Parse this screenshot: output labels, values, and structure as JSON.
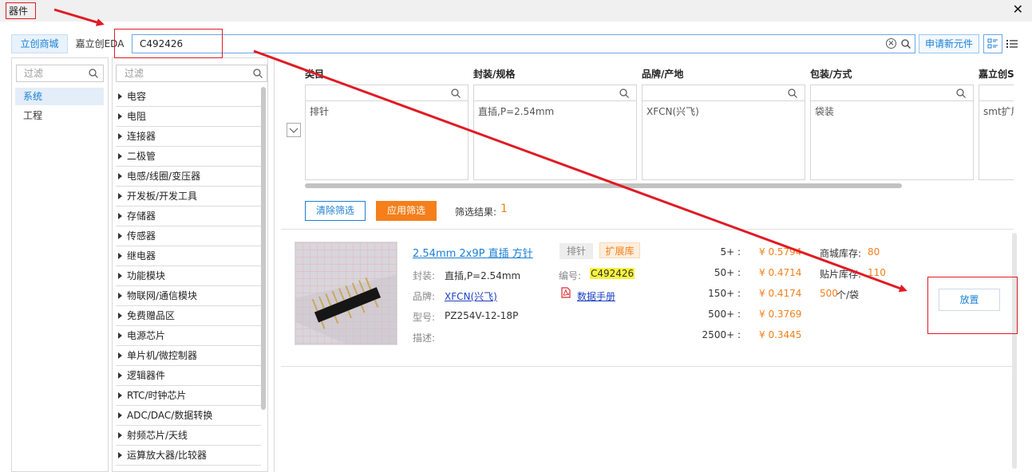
{
  "window": {
    "title": "器件"
  },
  "search": {
    "tab_mall": "立创商城",
    "tab_eda": "嘉立创EDA",
    "value": "C492426",
    "apply_new": "申请新元件"
  },
  "libraries": {
    "filter_placeholder": "过滤",
    "items": [
      "系统",
      "工程"
    ]
  },
  "categories": {
    "filter_placeholder": "过滤",
    "items": [
      "电容",
      "电阻",
      "连接器",
      "二极管",
      "电感/线圈/变压器",
      "开发板/开发工具",
      "存储器",
      "传感器",
      "继电器",
      "功能模块",
      "物联网/通信模块",
      "免费赠品区",
      "电源芯片",
      "单片机/微控制器",
      "逻辑器件",
      "RTC/时钟芯片",
      "ADC/DAC/数据转换",
      "射频芯片/天线",
      "运算放大器/比较器"
    ]
  },
  "filters": {
    "columns": [
      {
        "header": "类目",
        "value": "排针"
      },
      {
        "header": "封装/规格",
        "value": "直插,P=2.54mm"
      },
      {
        "header": "品牌/产地",
        "value": "XFCN(兴飞)"
      },
      {
        "header": "包装/方式",
        "value": "袋装"
      },
      {
        "header": "嘉立创S",
        "value": "smt扩展"
      }
    ],
    "clear_label": "清除筛选",
    "apply_label": "应用筛选",
    "result_label": "筛选结果:",
    "result_count": "1"
  },
  "product": {
    "title": "2.54mm 2x9P 直插 方针",
    "tag_type": "排针",
    "tag_lib": "扩展库",
    "package_label": "封装:",
    "package_value": "直插,P=2.54mm",
    "brand_label": "品牌:",
    "brand_value": "XFCN(兴飞)",
    "model_label": "型号:",
    "model_value": "PZ254V-12-18P",
    "desc_label": "描述:",
    "code_label": "编号:",
    "code_value": "C492426",
    "datasheet": "数据手册",
    "prices": [
      {
        "qty": "5+ :",
        "price": "¥ 0.5794"
      },
      {
        "qty": "50+ :",
        "price": "¥ 0.4714"
      },
      {
        "qty": "150+ :",
        "price": "¥ 0.4174"
      },
      {
        "qty": "500+ :",
        "price": "¥ 0.3769"
      },
      {
        "qty": "2500+ :",
        "price": "¥ 0.3445"
      }
    ],
    "mall_stock_label": "商城库存:",
    "mall_stock_value": "80",
    "smt_stock_label": "贴片库存:",
    "smt_stock_value": "110",
    "pack_count": "500",
    "pack_unit": "个/袋",
    "place_label": "放置"
  },
  "colors": {
    "accent": "#1b7fd4",
    "orange": "#f47f1b",
    "annotation_red": "#e01b24",
    "highlight": "#f7f23f"
  }
}
